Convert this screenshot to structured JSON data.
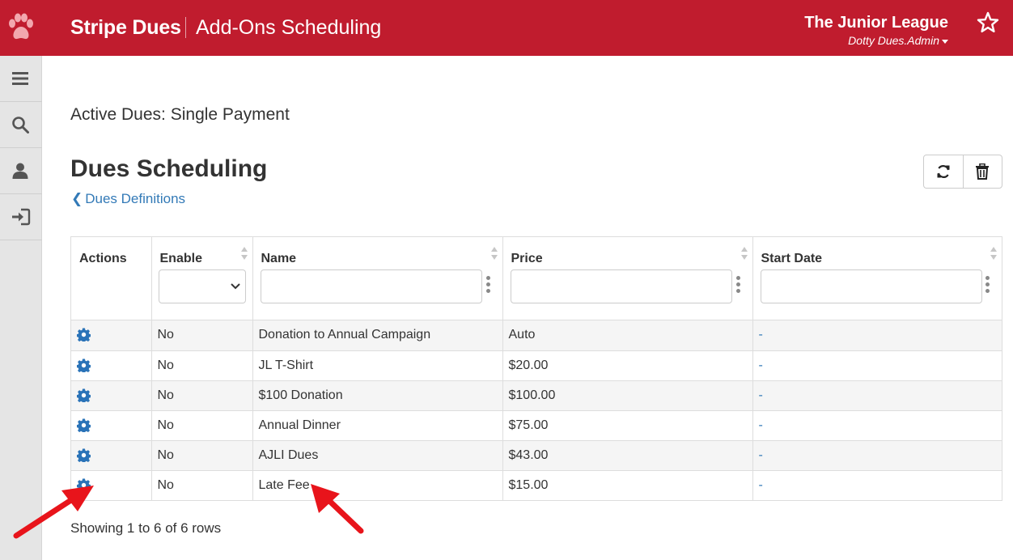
{
  "header": {
    "app_name": "Stripe Dues",
    "page_title": "Add-Ons Scheduling",
    "organization": "The Junior League",
    "user_name": "Dotty Dues.Admin",
    "logo_icon": "paw-icon",
    "favorite_icon": "star-icon",
    "bar_color": "#c01c2e"
  },
  "sidebar": {
    "items": [
      {
        "name": "menu",
        "icon": "hamburger-icon"
      },
      {
        "name": "search",
        "icon": "search-icon"
      },
      {
        "name": "profile",
        "icon": "user-icon"
      },
      {
        "name": "logout",
        "icon": "sign-out-icon"
      }
    ]
  },
  "main": {
    "subtitle": "Active Dues: Single Payment",
    "section_title": "Dues Scheduling",
    "back_link": "Dues Definitions",
    "toolbar": {
      "refresh_icon": "refresh-icon",
      "delete_icon": "trash-icon"
    },
    "table": {
      "columns": [
        "Actions",
        "Enable",
        "Name",
        "Price",
        "Start Date"
      ],
      "filters": {
        "enable_selected": "",
        "name": "",
        "price": "",
        "start_date": ""
      },
      "rows": [
        {
          "enable": "No",
          "name": "Donation to Annual Campaign",
          "price": "Auto",
          "start_date": "-"
        },
        {
          "enable": "No",
          "name": "JL T-Shirt",
          "price": "$20.00",
          "start_date": "-"
        },
        {
          "enable": "No",
          "name": "$100 Donation",
          "price": "$100.00",
          "start_date": "-"
        },
        {
          "enable": "No",
          "name": "Annual Dinner",
          "price": "$75.00",
          "start_date": "-"
        },
        {
          "enable": "No",
          "name": "AJLI Dues",
          "price": "$43.00",
          "start_date": "-"
        },
        {
          "enable": "No",
          "name": "Late Fee",
          "price": "$15.00",
          "start_date": "-"
        }
      ]
    },
    "pagination_text": "Showing 1 to 6 of 6 rows"
  },
  "colors": {
    "accent": "#c01c2e",
    "link": "#337ab7",
    "annotation_arrow": "#e8141b"
  }
}
